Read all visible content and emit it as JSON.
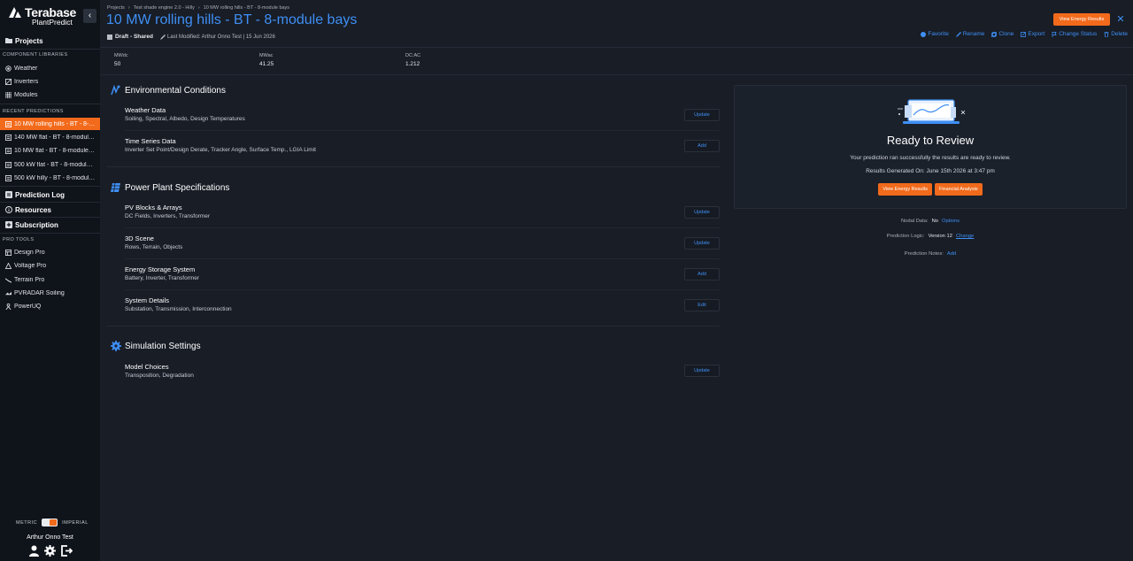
{
  "sidebar": {
    "brand": "Terabase",
    "brand_sub": "PlantPredict",
    "collapse_icon": "chevron-left-icon",
    "projects": "Projects",
    "component_libraries_heading": "COMPONENT LIBRARIES",
    "libraries": [
      {
        "label": "Weather",
        "icon": "sun-icon"
      },
      {
        "label": "Inverters",
        "icon": "inverter-icon"
      },
      {
        "label": "Modules",
        "icon": "grid-icon"
      }
    ],
    "recent_heading": "RECENT PREDICTIONS",
    "recent": [
      {
        "label": "10 MW rolling hills - BT - 8-m...",
        "active": true
      },
      {
        "label": "140 MW flat - BT - 8-module ..."
      },
      {
        "label": "10 MW flat - BT - 8-module b..."
      },
      {
        "label": "500 kW flat - BT - 8-module ..."
      },
      {
        "label": "500 kW hilly - BT - 8-module..."
      }
    ],
    "prediction_log": "Prediction Log",
    "resources": "Resources",
    "subscription": "Subscription",
    "pro_tools_heading": "PRO TOOLS",
    "pro_tools": [
      {
        "label": "Design Pro",
        "icon": "layout-icon"
      },
      {
        "label": "Voltage Pro",
        "icon": "triangle-icon"
      },
      {
        "label": "Terrain Pro",
        "icon": "terrain-icon"
      },
      {
        "label": "PVRADAR Soiling",
        "icon": "radar-icon"
      },
      {
        "label": "PowerUQ",
        "icon": "person-icon"
      }
    ],
    "units": {
      "metric": "METRIC",
      "imperial": "IMPERIAL"
    },
    "user_name": "Arthur Onno Test"
  },
  "header": {
    "breadcrumb": [
      "Projects",
      "Test shade engine 2.0 - Hilly",
      "10 MW rolling hills - BT - 8-module bays"
    ],
    "title": "10 MW rolling hills - BT - 8-module bays",
    "status": "Draft - Shared",
    "last_modified": "Last Modified: Arthur Onno Test | 15 Jun 2026",
    "view_results": "View Energy Results",
    "actions": [
      {
        "label": "Favorite",
        "icon": "star-icon"
      },
      {
        "label": "Rename",
        "icon": "pencil-icon"
      },
      {
        "label": "Clone",
        "icon": "clone-icon"
      },
      {
        "label": "Export",
        "icon": "export-icon"
      },
      {
        "label": "Change Status",
        "icon": "flag-icon"
      },
      {
        "label": "Delete",
        "icon": "trash-icon"
      }
    ]
  },
  "stats": [
    {
      "label": "MWdc",
      "value": "50"
    },
    {
      "label": "MWac",
      "value": "41.25"
    },
    {
      "label": "DC:AC",
      "value": "1.212"
    }
  ],
  "sections": [
    {
      "title": "Environmental Conditions",
      "icon": "environment-icon",
      "rows": [
        {
          "title": "Weather Data",
          "desc": "Soiling, Spectral, Albedo, Design Temperatures",
          "button": "Update"
        },
        {
          "title": "Time Series Data",
          "desc": "Inverter Set Point/Design Derate, Tracker Angle, Surface Temp., LGIA Limit",
          "button": "Add"
        }
      ]
    },
    {
      "title": "Power Plant Specifications",
      "icon": "solar-panel-icon",
      "rows": [
        {
          "title": "PV Blocks & Arrays",
          "desc": "DC Fields, Inverters, Transformer",
          "button": "Update"
        },
        {
          "title": "3D Scene",
          "desc": "Rows, Terrain, Objects",
          "button": "Update"
        },
        {
          "title": "Energy Storage System",
          "desc": "Battery, Inverter, Transformer",
          "button": "Add"
        },
        {
          "title": "System Details",
          "desc": "Substation, Transmission, Interconnection",
          "button": "Edit"
        }
      ]
    },
    {
      "title": "Simulation Settings",
      "icon": "gear-icon",
      "rows": [
        {
          "title": "Model Choices",
          "desc": "Transposition, Degradation",
          "button": "Update"
        }
      ]
    }
  ],
  "review": {
    "heading": "Ready to Review",
    "message": "Your prediction ran successfully the results are ready to review.",
    "generated": "Results Generated On: June 15th 2026 at 3:47 pm",
    "btn_results": "View Energy Results",
    "btn_financial": "Financial Analysis"
  },
  "info": {
    "nodal_label": "Nodal Data:",
    "nodal_value": "No",
    "nodal_link": "Options",
    "logic_label": "Prediction Logic:",
    "logic_value": "Version 12",
    "logic_link": "Change",
    "notes_label": "Prediction Notes:",
    "notes_link": "Add"
  },
  "colors": {
    "accent": "#f26a1b",
    "link": "#3f8ff4",
    "bg": "#181d26",
    "sidebar": "#0f131a"
  }
}
